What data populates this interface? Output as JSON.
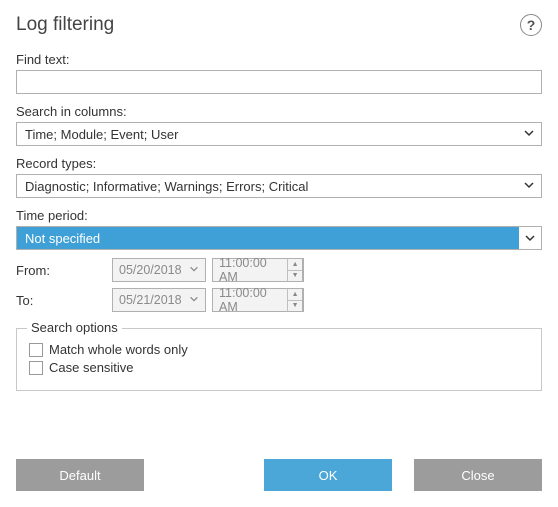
{
  "title": "Log filtering",
  "labels": {
    "find_text": "Find text:",
    "search_in_columns": "Search in columns:",
    "record_types": "Record types:",
    "time_period": "Time period:",
    "from": "From:",
    "to": "To:",
    "search_options": "Search options"
  },
  "values": {
    "find_text": "",
    "columns": "Time; Module; Event; User",
    "record_types": "Diagnostic; Informative; Warnings; Errors; Critical",
    "time_period": "Not specified",
    "from_date": "05/20/2018",
    "from_time": "11:00:00 AM",
    "to_date": "05/21/2018",
    "to_time": "11:00:00 AM"
  },
  "checks": {
    "whole_words": "Match whole words only",
    "case_sensitive": "Case sensitive"
  },
  "buttons": {
    "default": "Default",
    "ok": "OK",
    "close": "Close"
  }
}
